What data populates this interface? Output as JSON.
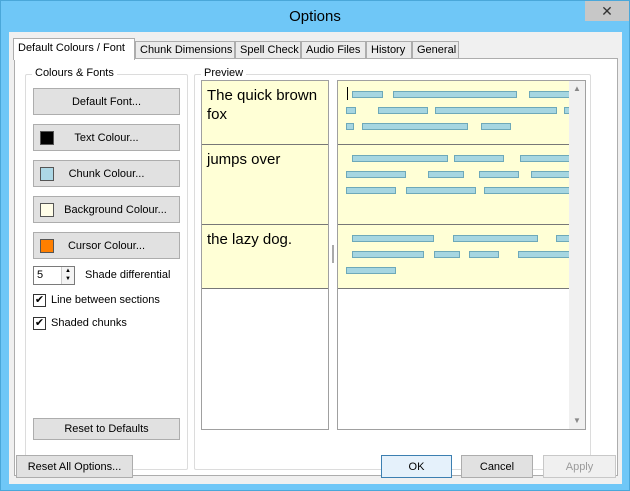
{
  "window": {
    "title": "Options",
    "close_glyph": "✕"
  },
  "tabs": [
    {
      "label": "Default Colours / Font",
      "active": true
    },
    {
      "label": "Chunk Dimensions"
    },
    {
      "label": "Spell Check"
    },
    {
      "label": "Audio Files"
    },
    {
      "label": "History"
    },
    {
      "label": "General"
    }
  ],
  "colours_fonts": {
    "group_label": "Colours & Fonts",
    "default_font_label": "Default Font...",
    "text_colour_label": "Text Colour...",
    "chunk_colour_label": "Chunk Colour...",
    "background_colour_label": "Background Colour...",
    "cursor_colour_label": "Cursor Colour...",
    "shade_value": "5",
    "shade_label": "Shade differential",
    "line_between_label": "Line between sections",
    "line_between_checked": true,
    "shaded_chunks_label": "Shaded chunks",
    "shaded_chunks_checked": true,
    "reset_defaults_label": "Reset to Defaults",
    "swatch_colors": {
      "text": "#000000",
      "chunk": "#add8e6",
      "background": "#fffde8",
      "cursor": "#ff7f00"
    }
  },
  "preview": {
    "group_label": "Preview",
    "sections": [
      {
        "text": "The quick brown fox"
      },
      {
        "text": "jumps over"
      },
      {
        "text": "the lazy dog."
      }
    ]
  },
  "footer": {
    "reset_all_label": "Reset All Options...",
    "ok_label": "OK",
    "cancel_label": "Cancel",
    "apply_label": "Apply"
  },
  "colors": {
    "chunk_fill": "#a6d6e1",
    "section_bg": "#ffffd6",
    "title_bar": "#6fc7f7"
  }
}
